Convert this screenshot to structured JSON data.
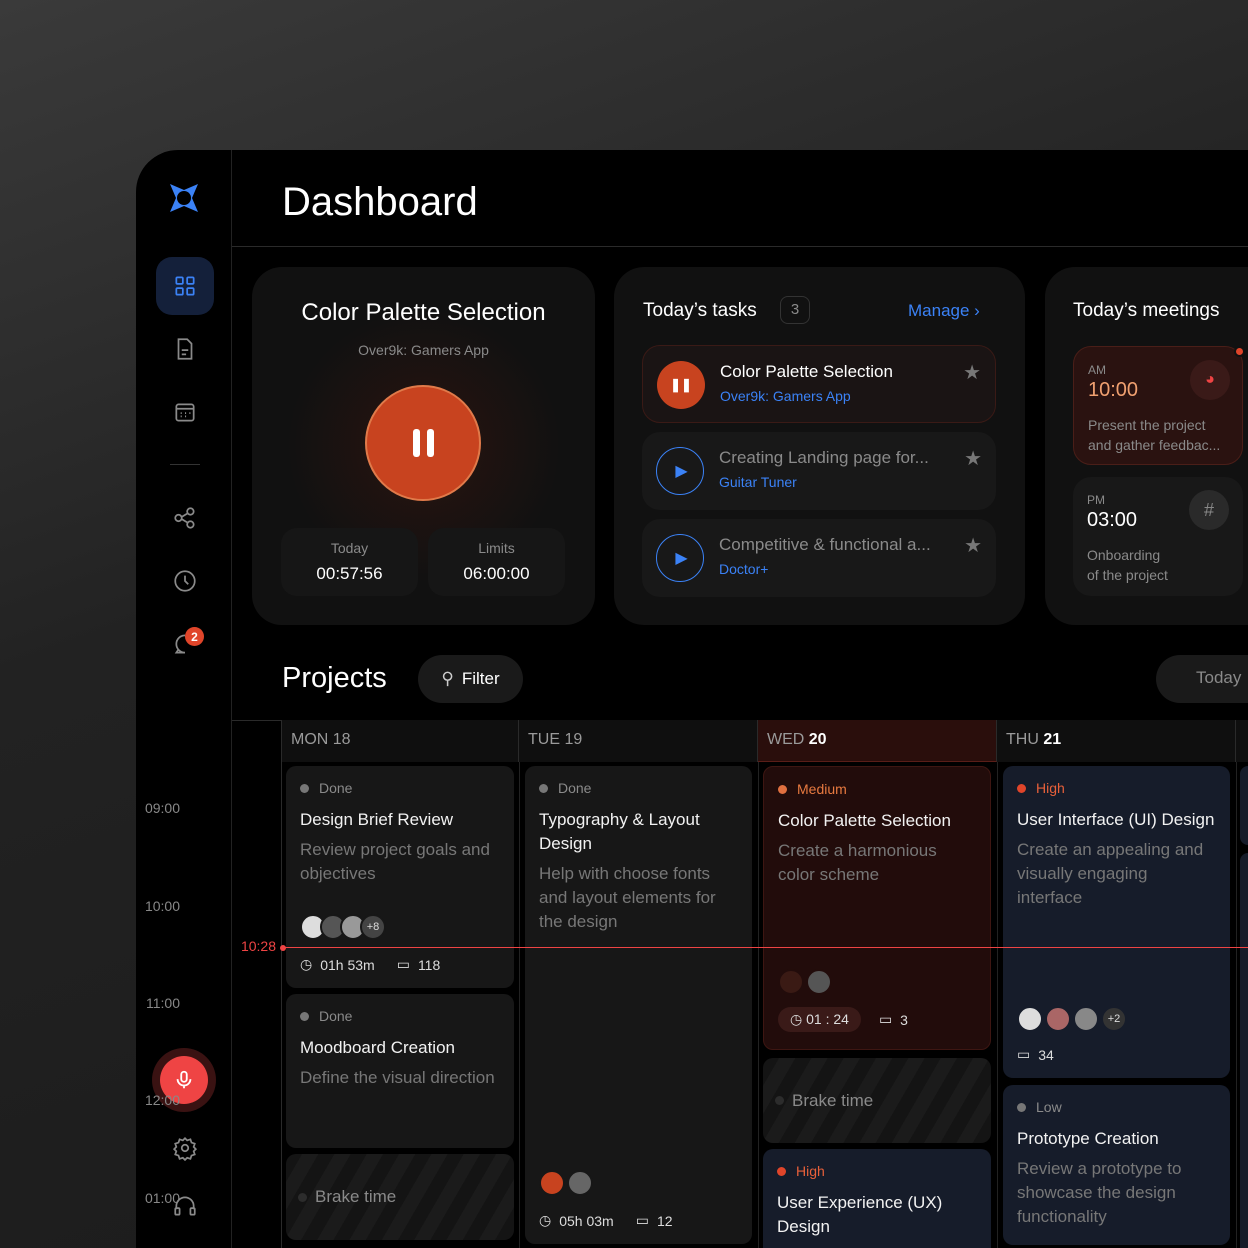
{
  "header": {
    "title": "Dashboard"
  },
  "sidebar": {
    "items": [
      {
        "icon": "grid-icon",
        "active": true
      },
      {
        "icon": "document-icon"
      },
      {
        "icon": "calendar-icon"
      },
      {
        "icon": "share-icon"
      },
      {
        "icon": "clock-icon"
      },
      {
        "icon": "chat-icon",
        "badge": "2"
      }
    ],
    "bottom": [
      {
        "icon": "microphone-icon"
      },
      {
        "icon": "gear-icon"
      },
      {
        "icon": "headset-icon"
      }
    ]
  },
  "timer": {
    "title": "Color Palette Selection",
    "project": "Over9k: Gamers App",
    "today_label": "Today",
    "today_value": "00:57:56",
    "limits_label": "Limits",
    "limits_value": "06:00:00"
  },
  "tasks": {
    "title": "Today’s tasks",
    "count": "3",
    "manage": "Manage",
    "items": [
      {
        "title": "Color Palette Selection",
        "project": "Over9k: Gamers App",
        "state": "playing"
      },
      {
        "title": "Creating Landing page for...",
        "project": "Guitar Tuner",
        "state": "paused"
      },
      {
        "title": "Competitive & functional a...",
        "project": "Doctor+",
        "state": "paused"
      }
    ]
  },
  "meetings": {
    "title": "Today’s meetings",
    "items": [
      {
        "period": "AM",
        "time": "10:00",
        "desc1": "Present the project",
        "desc2": "and gather feedbac...",
        "app": "discord-icon"
      },
      {
        "period": "PM",
        "time": "03:00",
        "desc1": "Onboarding",
        "desc2": "of the project",
        "app": "slack-icon"
      }
    ]
  },
  "projects": {
    "title": "Projects",
    "filter": "Filter",
    "today": "Today"
  },
  "calendar": {
    "days": [
      {
        "dow": "MON",
        "num": "18"
      },
      {
        "dow": "TUE",
        "num": "19"
      },
      {
        "dow": "WED",
        "num": "20"
      },
      {
        "dow": "THU",
        "num": "21"
      }
    ],
    "times": [
      "09:00",
      "10:00",
      "11:00",
      "12:00",
      "01:00"
    ],
    "now": "10:28",
    "events": {
      "mon1": {
        "status": "Done",
        "title": "Design Brief Review",
        "desc": "Review project goals and objectives",
        "more": "+8",
        "time": "01h 53m",
        "comments": "118"
      },
      "mon2": {
        "status": "Done",
        "title": "Moodboard Creation",
        "desc": "Define the visual direction"
      },
      "mon_brake": "Brake time",
      "tue1": {
        "status": "Done",
        "title": "Typography & Layout Design",
        "desc": "Help with choose fonts and layout elements for the design",
        "time": "05h 03m",
        "comments": "12"
      },
      "wed1": {
        "status": "Medium",
        "title": "Color Palette Selection",
        "desc": "Create a harmonious color scheme",
        "time": "01 : 24",
        "comments": "3"
      },
      "wed_brake": "Brake time",
      "wed2": {
        "status": "High",
        "title": "User Experience (UX) Design"
      },
      "thu1": {
        "status": "High",
        "title": "User Interface (UI) Design",
        "desc": "Create an appealing and visually engaging interface",
        "more": "+2",
        "comments": "34"
      },
      "thu2": {
        "status": "Low",
        "title": "Prototype Creation",
        "desc": "Review a prototype to showcase the design functionality"
      }
    }
  },
  "colors": {
    "accent": "#3b82f6",
    "orange": "#c8431f",
    "now": "#ef4444"
  }
}
